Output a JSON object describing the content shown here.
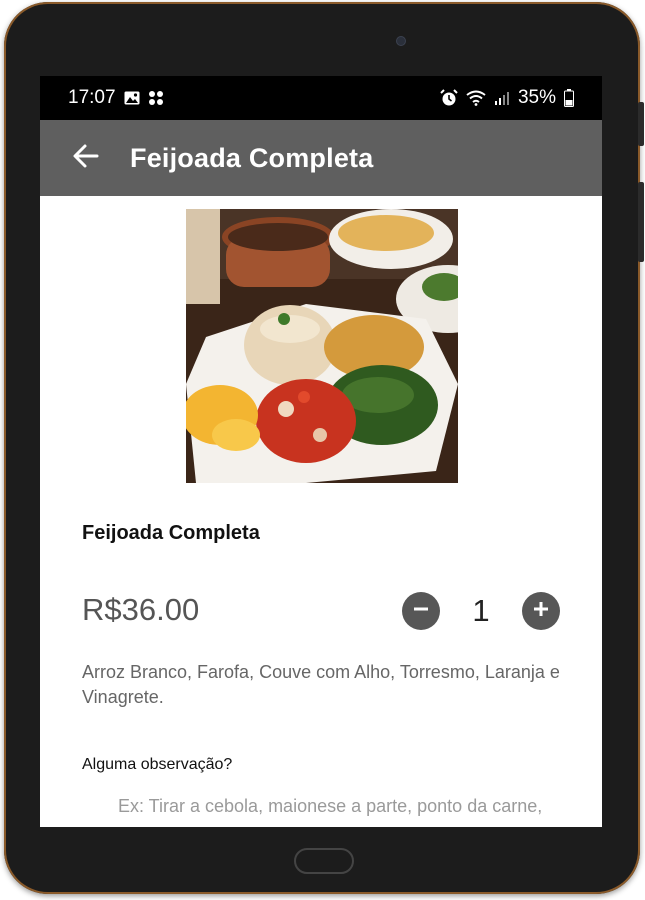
{
  "status_bar": {
    "time": "17:07",
    "battery": "35%",
    "icons": [
      "image-notification-icon",
      "apps-notification-icon",
      "alarm-icon",
      "wifi-icon",
      "signal-icon",
      "battery-icon"
    ]
  },
  "app_bar": {
    "title": "Feijoada Completa",
    "back_icon": "arrow-back-icon",
    "color": "#5f5f5f"
  },
  "product": {
    "name": "Feijoada Completa",
    "price": "R$36.00",
    "quantity": "1",
    "description": "Arroz Branco, Farofa, Couve com Alho, Torresmo, Laranja e Vinagrete."
  },
  "observation": {
    "label": "Alguma observação?",
    "placeholder": "Ex: Tirar a cebola, maionese a parte, ponto da carne, etc."
  }
}
